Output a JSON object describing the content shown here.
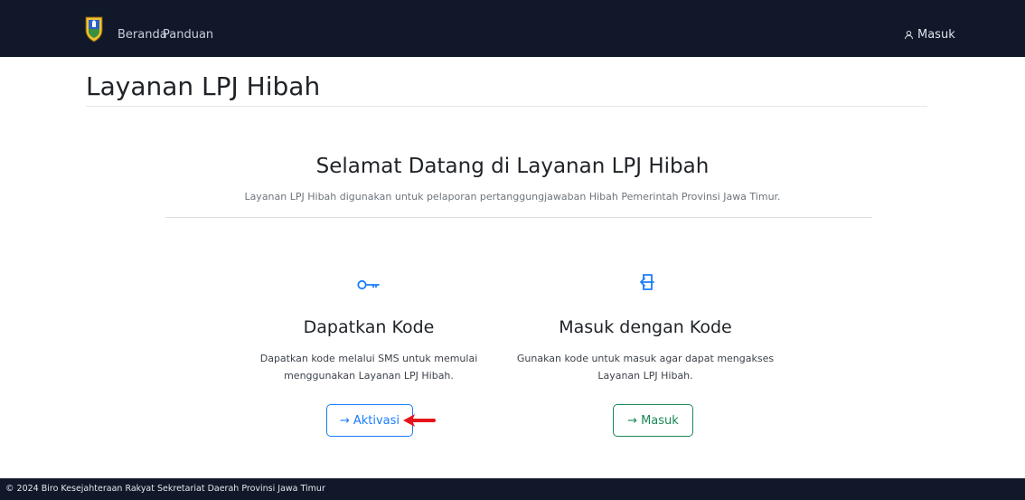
{
  "navbar": {
    "logo_icon": "province-crest-icon",
    "home_label": "Beranda",
    "guide_label": "Panduan",
    "login_icon": "user-icon",
    "login_label": "Masuk"
  },
  "page": {
    "title": "Layanan LPJ Hibah"
  },
  "welcome": {
    "title": "Selamat Datang di Layanan LPJ Hibah",
    "subtitle": "Layanan LPJ Hibah digunakan untuk pelaporan pertanggungjawaban Hibah Pemerintah Provinsi Jawa Timur."
  },
  "cards": [
    {
      "icon": "key-icon",
      "title": "Dapatkan Kode",
      "description_line1": "Dapatkan kode melalui SMS untuk memulai",
      "description_line2": "menggunakan Layanan LPJ Hibah.",
      "button_label": "Aktivasi",
      "button_arrow": "→"
    },
    {
      "icon": "sign-in-icon",
      "title": "Masuk dengan Kode",
      "description_line1": "Gunakan kode untuk masuk agar dapat mengakses",
      "description_line2": "Layanan LPJ Hibah.",
      "button_label": "Masuk",
      "button_arrow": "→"
    }
  ],
  "footer": {
    "text": "© 2024 Biro Kesejahteraan Rakyat Sekretariat Daerah Provinsi Jawa Timur"
  },
  "colors": {
    "navbar_bg": "#101829",
    "primary": "#1a7dfb",
    "success": "#198754",
    "annotation_red": "#e8141b"
  }
}
